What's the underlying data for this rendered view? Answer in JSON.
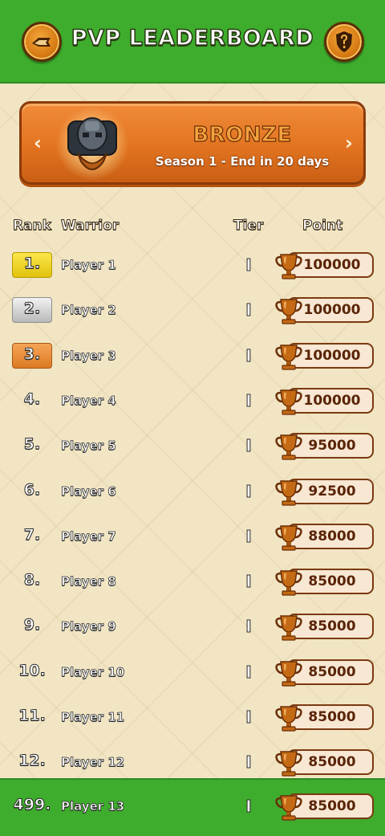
{
  "header": {
    "title": "PVP LEADERBOARD",
    "back_icon": "scroll-back-icon",
    "help_icon": "question-shield-icon"
  },
  "season_banner": {
    "tier_name": "BRONZE",
    "season_text": "Season 1 - End in 20 days",
    "prev_arrow": "‹",
    "next_arrow": "›",
    "badge_icon": "bronze-tier-badge-icon"
  },
  "columns": {
    "rank": "Rank",
    "warrior": "Warrior",
    "tier": "Tier",
    "point": "Point"
  },
  "rows": [
    {
      "rank": "1.",
      "name": "Player 1",
      "tier": "I",
      "points": "100000"
    },
    {
      "rank": "2.",
      "name": "Player 2",
      "tier": "I",
      "points": "100000"
    },
    {
      "rank": "3.",
      "name": "Player 3",
      "tier": "I",
      "points": "100000"
    },
    {
      "rank": "4.",
      "name": "Player 4",
      "tier": "I",
      "points": "100000"
    },
    {
      "rank": "5.",
      "name": "Player 5",
      "tier": "I",
      "points": "95000"
    },
    {
      "rank": "6.",
      "name": "Player 6",
      "tier": "I",
      "points": "92500"
    },
    {
      "rank": "7.",
      "name": "Player 7",
      "tier": "I",
      "points": "88000"
    },
    {
      "rank": "8.",
      "name": "Player 8",
      "tier": "I",
      "points": "85000"
    },
    {
      "rank": "9.",
      "name": "Player 9",
      "tier": "I",
      "points": "85000"
    },
    {
      "rank": "10.",
      "name": "Player 10",
      "tier": "I",
      "points": "85000"
    },
    {
      "rank": "11.",
      "name": "Player 11",
      "tier": "I",
      "points": "85000"
    },
    {
      "rank": "12.",
      "name": "Player 12",
      "tier": "I",
      "points": "85000"
    }
  ],
  "current_player": {
    "rank": "499.",
    "name": "Player 13",
    "tier": "I",
    "points": "85000"
  },
  "colors": {
    "header_green": "#3eac2c",
    "banner_orange": "#e27420",
    "gold": "#f3d92a",
    "silver": "#cfcfcf",
    "bronze": "#e98b3a",
    "trophy": "#c46a14"
  }
}
